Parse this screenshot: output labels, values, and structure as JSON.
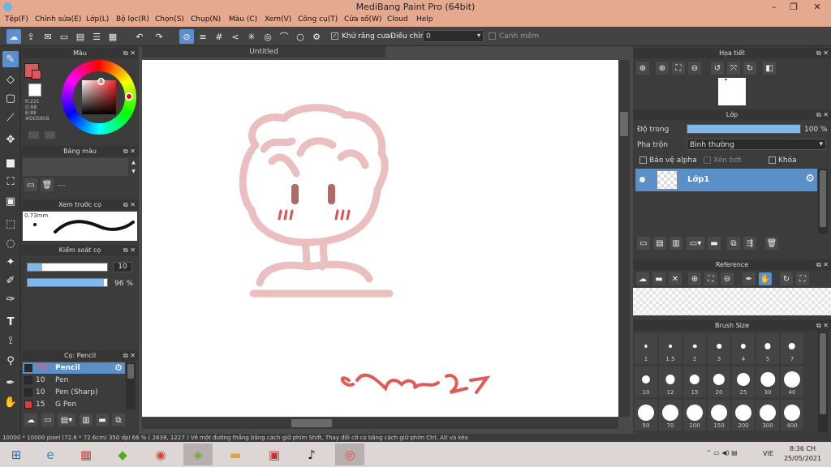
{
  "window": {
    "title": "MediBang Paint Pro (64bit)"
  },
  "menu": [
    "Tệp(F)",
    "Chỉnh sửa(E)",
    "Lớp(L)",
    "Bộ lọc(R)",
    "Chọn(S)",
    "Chụp(N)",
    "Màu (C)",
    "Xem(V)",
    "Công cụ(T)",
    "Cửa số(W)",
    "Cloud",
    "Help"
  ],
  "toolbar": {
    "antialias_label": "Khử răng cưa",
    "adjust_label": "Điều chỉnh",
    "adjust_value": "0",
    "smooth_label": "Canh mềm"
  },
  "color_panel": {
    "title": "Màu",
    "rgb": "R:221\nG:88\nB:88\n#DD5858",
    "main_color": "#dd5858"
  },
  "palette_panel": {
    "title": "Bảng màu",
    "dash": "---"
  },
  "brush_preview": {
    "title": "Xem trước cọ",
    "size": "0.73mm"
  },
  "brush_control": {
    "title": "Kiểm soát cọ",
    "size_value": "10",
    "opacity_value": "96 %",
    "opacity_fraction": 0.96
  },
  "brush_list": {
    "title": "Cọ: Pencil",
    "items": [
      {
        "size": "10",
        "name": "Pencil",
        "color": "#2a2a2a",
        "selected": true
      },
      {
        "size": "10",
        "name": "Pen",
        "color": "#2a2a2a",
        "selected": false
      },
      {
        "size": "10",
        "name": "Pen (Sharp)",
        "color": "#2a2a2a",
        "selected": false
      },
      {
        "size": "15",
        "name": "G Pen",
        "color": "#e53a3a",
        "selected": false
      }
    ]
  },
  "canvas": {
    "tab": "Untitled"
  },
  "navigator": {
    "title": "Họa tiết"
  },
  "layer_panel": {
    "title": "Lớp",
    "opacity_label": "Độ trong",
    "opacity_value": "100 %",
    "blend_label": "Pha trộn",
    "blend_value": "Bình thường",
    "protect_alpha": "Bảo vệ alpha",
    "clipping": "Xén bớt",
    "lock": "Khóa",
    "layer_name": "Lớp1"
  },
  "reference": {
    "title": "Reference"
  },
  "brush_size": {
    "title": "Brush Size",
    "sizes": [
      "1",
      "1.5",
      "2",
      "3",
      "4",
      "5",
      "7",
      "10",
      "12",
      "15",
      "20",
      "25",
      "30",
      "40",
      "50",
      "70",
      "100",
      "150",
      "200",
      "300",
      "400"
    ]
  },
  "status": {
    "text": "10000 * 10000 pixel   (72.6 * 72.6cm)   350 dpi   66 %   ( 2838, 1227 )   Vẽ một đường thẳng bằng cách giữ phím Shift, Thay đổi cỡ cọ bằng cách giữ phím Ctrl, Alt và kéo"
  },
  "taskbar": {
    "time": "8:36 CH",
    "date": "25/05/2021",
    "lang": "VIE"
  }
}
